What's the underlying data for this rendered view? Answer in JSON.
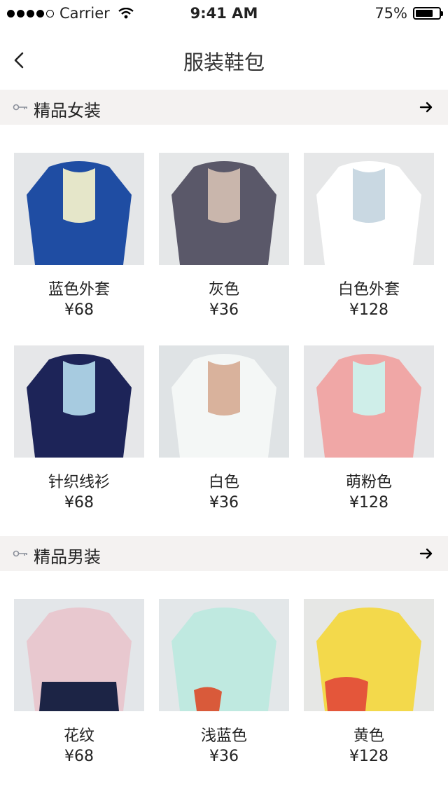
{
  "status_bar": {
    "carrier": "Carrier",
    "time": "9:41 AM",
    "battery": "75%",
    "battery_level": 0.75
  },
  "nav": {
    "title": "服装鞋包",
    "back_icon": "chevron-left-icon"
  },
  "sections": [
    {
      "title": "精品女装",
      "icon": "key-icon",
      "more_icon": "arrow-right-icon",
      "products": [
        {
          "name": "蓝色外套",
          "price": "¥68",
          "colors": [
            "#e4e6e8",
            "#1f4da3",
            "#e5e6c9"
          ]
        },
        {
          "name": "灰色",
          "price": "¥36",
          "colors": [
            "#e5e7e8",
            "#5a5869",
            "#c9b6ac"
          ]
        },
        {
          "name": "白色外套",
          "price": "¥128",
          "colors": [
            "#e6e7e8",
            "#ffffff",
            "#c9d8e2"
          ]
        },
        {
          "name": "针织线衫",
          "price": "¥68",
          "colors": [
            "#e6e7e9",
            "#1d2458",
            "#a7cbe0"
          ]
        },
        {
          "name": "白色",
          "price": "¥36",
          "colors": [
            "#dfe3e5",
            "#f4f7f6",
            "#d9b29c"
          ]
        },
        {
          "name": "萌粉色",
          "price": "¥128",
          "colors": [
            "#e5e6e8",
            "#f0a7a6",
            "#cfeee9"
          ]
        }
      ]
    },
    {
      "title": "精品男装",
      "icon": "key-icon",
      "more_icon": "arrow-right-icon",
      "products": [
        {
          "name": "花纹",
          "price": "¥68",
          "colors": [
            "#e3e6e9",
            "#e8c8cf",
            "#1c2445"
          ]
        },
        {
          "name": "浅蓝色",
          "price": "¥36",
          "colors": [
            "#e3e7e9",
            "#bfe9e0",
            "#d95a3a"
          ]
        },
        {
          "name": "黄色",
          "price": "¥128",
          "colors": [
            "#e6e7e5",
            "#f3d94b",
            "#e4563a"
          ]
        }
      ]
    }
  ]
}
